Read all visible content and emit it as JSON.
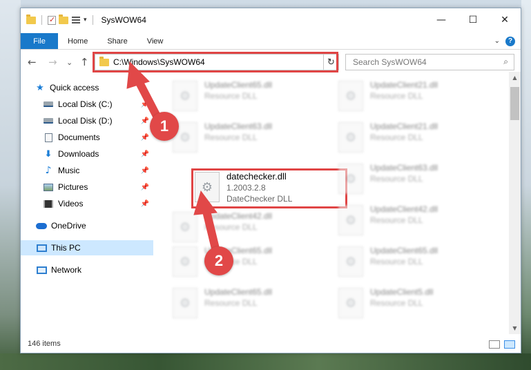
{
  "window": {
    "title": "SysWOW64",
    "minimize": "—",
    "maximize": "☐",
    "close": "✕"
  },
  "ribbon": {
    "tabs": [
      "File",
      "Home",
      "Share",
      "View"
    ],
    "help": "?"
  },
  "nav": {
    "back": "←",
    "forward": "→",
    "recent": "⌄",
    "up": "↑"
  },
  "address": {
    "path": "C:\\Windows\\SysWOW64",
    "refresh": "↻",
    "dropdown": "⌄"
  },
  "search": {
    "placeholder": "Search SysWOW64",
    "icon": "search-icon"
  },
  "sidebar": {
    "items": [
      {
        "label": "Quick access",
        "icon": "star-icon"
      },
      {
        "label": "Local Disk (C:)",
        "icon": "drive-icon"
      },
      {
        "label": "Local Disk (D:)",
        "icon": "drive-icon"
      },
      {
        "label": "Documents",
        "icon": "documents-icon"
      },
      {
        "label": "Downloads",
        "icon": "downloads-icon"
      },
      {
        "label": "Music",
        "icon": "music-icon"
      },
      {
        "label": "Pictures",
        "icon": "pictures-icon"
      },
      {
        "label": "Videos",
        "icon": "videos-icon"
      },
      {
        "label": "OneDrive",
        "icon": "onedrive-icon"
      },
      {
        "label": "This PC",
        "icon": "this-pc-icon"
      },
      {
        "label": "Network",
        "icon": "network-icon"
      }
    ]
  },
  "files": [
    {
      "name": "UpdateClient65.dll",
      "type": "Resource DLL"
    },
    {
      "name": "UpdateClient21.dll",
      "type": "Resource DLL"
    },
    {
      "name": "UpdateClient63.dll",
      "type": "Resource DLL"
    },
    {
      "name": "UpdateClient21.dll",
      "type": "Resource DLL"
    },
    {
      "name": "datechecker.dll",
      "version": "1.2003.2.8",
      "type": "DateChecker DLL"
    },
    {
      "name": "UpdateClient63.dll",
      "type": "Resource DLL"
    },
    {
      "name": "UpdateClient42.dll",
      "type": "Resource DLL"
    },
    {
      "name": "UpdateClient42.dll",
      "type": "Resource DLL"
    },
    {
      "name": "UpdateClient65.dll",
      "type": "Resource DLL"
    },
    {
      "name": "UpdateClient65.dll",
      "type": "Resource DLL"
    },
    {
      "name": "UpdateClient65.dll",
      "type": "Resource DLL"
    },
    {
      "name": "UpdateClient5.dll",
      "type": "Resource DLL"
    }
  ],
  "status": {
    "item_count": "146 items"
  },
  "callouts": {
    "one": "1",
    "two": "2",
    "color": "#e14848"
  }
}
